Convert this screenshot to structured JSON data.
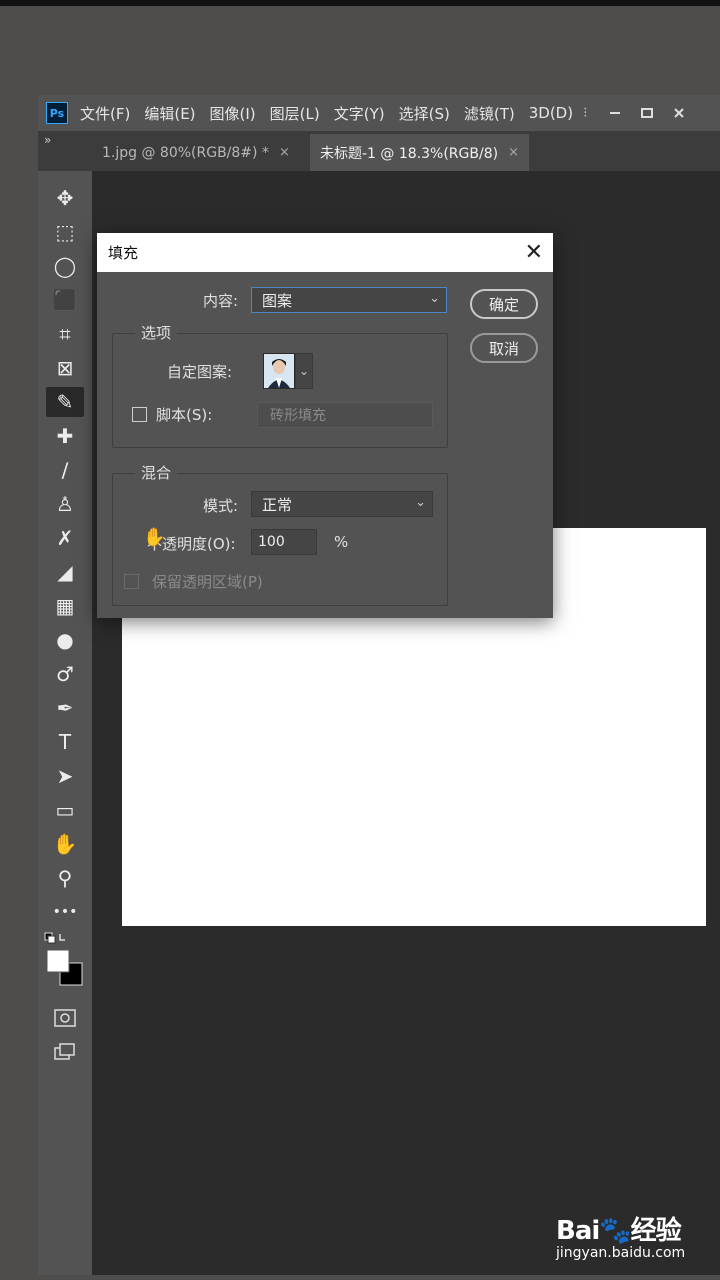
{
  "menu": {
    "logo": "Ps",
    "items": [
      "文件(F)",
      "编辑(E)",
      "图像(I)",
      "图层(L)",
      "文字(Y)",
      "选择(S)",
      "滤镜(T)",
      "3D(D)"
    ],
    "more": "⁝"
  },
  "tabs": [
    {
      "label": "1.jpg @ 80%(RGB/8#) *",
      "close": "×"
    },
    {
      "label": "未标题-1 @ 18.3%(RGB/8)",
      "close": "×"
    }
  ],
  "collapse_label": "»",
  "tools": [
    {
      "name": "move-tool-icon",
      "glyph": "✥"
    },
    {
      "name": "marquee-tool-icon",
      "glyph": "⬚"
    },
    {
      "name": "lasso-tool-icon",
      "glyph": "◯"
    },
    {
      "name": "object-select-tool-icon",
      "glyph": "⬛"
    },
    {
      "name": "crop-tool-icon",
      "glyph": "⌗"
    },
    {
      "name": "frame-tool-icon",
      "glyph": "⊠"
    },
    {
      "name": "eyedropper-tool-icon",
      "glyph": "✎"
    },
    {
      "name": "healing-brush-tool-icon",
      "glyph": "✚"
    },
    {
      "name": "brush-tool-icon",
      "glyph": "∕"
    },
    {
      "name": "stamp-tool-icon",
      "glyph": "♙"
    },
    {
      "name": "history-brush-tool-icon",
      "glyph": "✗"
    },
    {
      "name": "eraser-tool-icon",
      "glyph": "◢"
    },
    {
      "name": "gradient-tool-icon",
      "glyph": "▦"
    },
    {
      "name": "blur-tool-icon",
      "glyph": "●"
    },
    {
      "name": "dodge-tool-icon",
      "glyph": "♂"
    },
    {
      "name": "pen-tool-icon",
      "glyph": "✒"
    },
    {
      "name": "type-tool-icon",
      "glyph": "T"
    },
    {
      "name": "path-select-tool-icon",
      "glyph": "➤"
    },
    {
      "name": "rectangle-tool-icon",
      "glyph": "▭"
    },
    {
      "name": "hand-tool-icon",
      "glyph": "✋"
    },
    {
      "name": "zoom-tool-icon",
      "glyph": "⚲"
    },
    {
      "name": "more-tools-icon",
      "glyph": "•••"
    }
  ],
  "dialog": {
    "title": "填充",
    "close": "✕",
    "content_label": "内容:",
    "content_value": "图案",
    "options_group": "选项",
    "custom_pattern_label": "自定图案:",
    "script_label": "脚本(S):",
    "script_value": "砖形填充",
    "blend_group": "混合",
    "mode_label": "模式:",
    "mode_value": "正常",
    "opacity_label": "不透明度(O):",
    "opacity_value": "100",
    "opacity_unit": "%",
    "preserve_label": "保留透明区域(P)",
    "ok_label": "确定",
    "cancel_label": "取消",
    "chevron": "⌄"
  },
  "watermark": {
    "main": "Bai🐾经验",
    "sub": "jingyan.baidu.com"
  }
}
